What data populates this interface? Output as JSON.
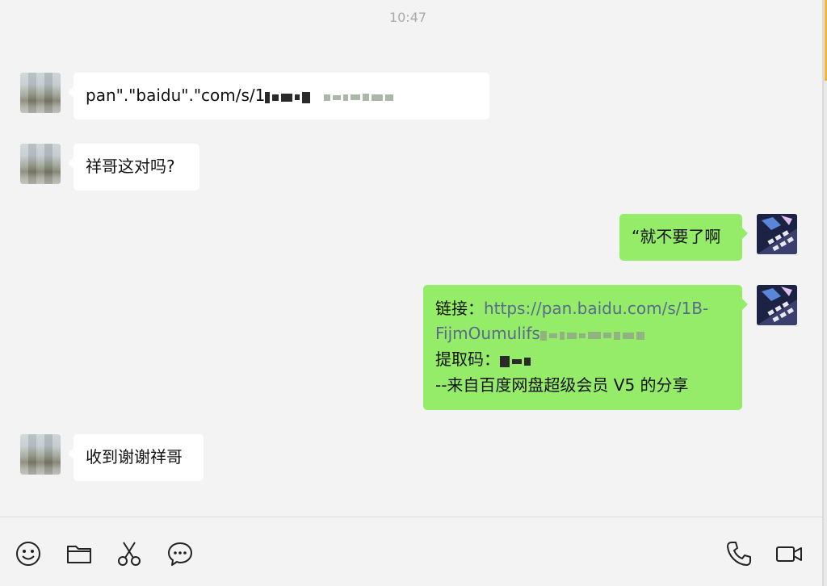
{
  "time": "10:47",
  "messages": [
    {
      "side": "left",
      "text": "pan\".\"baidu\".\"com/s/1"
    },
    {
      "side": "left",
      "text": "祥哥这对吗?"
    },
    {
      "side": "right",
      "text": "“就不要了啊"
    },
    {
      "side": "right",
      "line1_label": "链接：",
      "line1_link": "https://pan.baidu.com/s/1B-",
      "line2_link": "FijmOumulifs",
      "line3_label": "提取码：",
      "line4": "--来自百度网盘超级会员 V5 的分享"
    },
    {
      "side": "left",
      "text": "收到谢谢祥哥"
    }
  ],
  "toolbar": {
    "left": [
      "emoji-icon",
      "folder-icon",
      "scissors-icon",
      "chat-history-icon"
    ],
    "right": [
      "phone-icon",
      "video-call-icon"
    ]
  },
  "colors": {
    "outgoing": "#95ec69",
    "incoming": "#ffffff",
    "link": "#586b8f",
    "background": "#f3f3f3"
  }
}
